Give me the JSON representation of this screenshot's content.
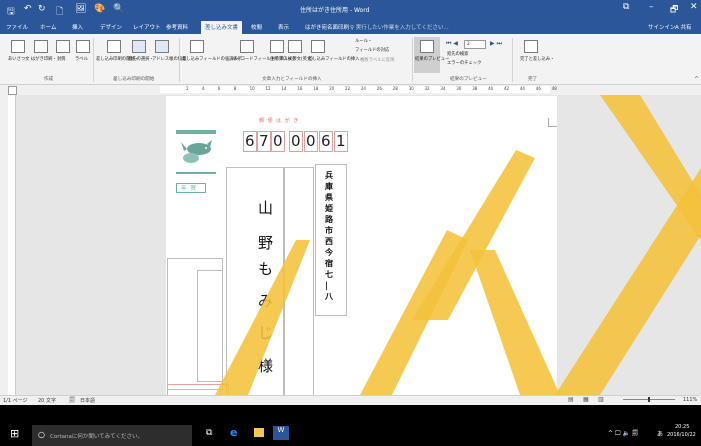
{
  "window": {
    "title": "住所はがき住所用 - Word",
    "quick_access": [
      "💾",
      "↶",
      "↻",
      "🗋",
      "🖼",
      "🎨",
      "🔍"
    ],
    "controls": [
      "⧉",
      "–",
      "🗗",
      "✕"
    ]
  },
  "tabs": [
    {
      "label": "ファイル",
      "active": false
    },
    {
      "label": "ホーム",
      "active": false
    },
    {
      "label": "挿入",
      "active": false
    },
    {
      "label": "デザイン",
      "active": false
    },
    {
      "label": "レイアウト",
      "active": false
    },
    {
      "label": "参考資料",
      "active": false
    },
    {
      "label": "差し込み文書",
      "active": true
    },
    {
      "label": "校閲",
      "active": false
    },
    {
      "label": "表示",
      "active": false
    },
    {
      "label": "はがき宛名面印刷",
      "active": false
    }
  ],
  "tell_me": "♀ 実行したい作業を入力してください...",
  "sign_in": "サインイン",
  "share": "A 共有",
  "ribbon": {
    "groups": [
      {
        "name": "作成",
        "items": [
          "あいさつ文・",
          "はがき印刷・",
          "封筒",
          "ラベル"
        ]
      },
      {
        "name": "差し込み印刷の開始",
        "items": [
          "差し込み印刷の開始・",
          "宛先の選択・",
          "アドレス帳の編集"
        ]
      },
      {
        "name": "文章入力とフィールドの挿入",
        "items": [
          "差し込みフィールドの強調表示",
          "バーコードフィールドの挿入・",
          "住所ブロック",
          "挨拶文(英文)",
          "差し込みフィールドの挿入・"
        ]
      },
      {
        "name": "結果のプレビュー",
        "items": [
          "結果のプレビュー"
        ]
      },
      {
        "name": "完了",
        "items": [
          "完了と差し込み・"
        ]
      }
    ],
    "rules_label": "ルール・",
    "field_match_label": "フィールドの対応",
    "update_labels": "複数ラベルに反映",
    "find_recipient": "宛先の検索",
    "error_check": "エラーのチェック",
    "record_number": "2"
  },
  "ruler_ticks": [
    "2",
    "4",
    "6",
    "8",
    "10",
    "12",
    "14",
    "16",
    "18",
    "20",
    "22",
    "24",
    "26",
    "28",
    "30",
    "32",
    "34",
    "36",
    "38",
    "40",
    "42",
    "44",
    "46",
    "48"
  ],
  "postcard": {
    "header_label": "郵 便 は が き",
    "postal_digits": [
      "6",
      "7",
      "0",
      "0",
      "0",
      "6",
      "1"
    ],
    "stamp_text": "年賀",
    "recipient_name": [
      "山",
      "野",
      "も",
      "み",
      "じ",
      "様"
    ],
    "address": [
      "兵",
      "庫",
      "県",
      "姫",
      "路",
      "市",
      "西",
      "今",
      "宿",
      "七",
      "|",
      "八"
    ]
  },
  "status": {
    "page": "1/1 ページ",
    "words": "20 文字",
    "lang": "日本語",
    "zoom": "111%"
  },
  "taskbar": {
    "cortana": "Cortanaに何か聞いてみてください。",
    "time": "20:25",
    "date": "2016/10/22",
    "ime": "あ"
  }
}
